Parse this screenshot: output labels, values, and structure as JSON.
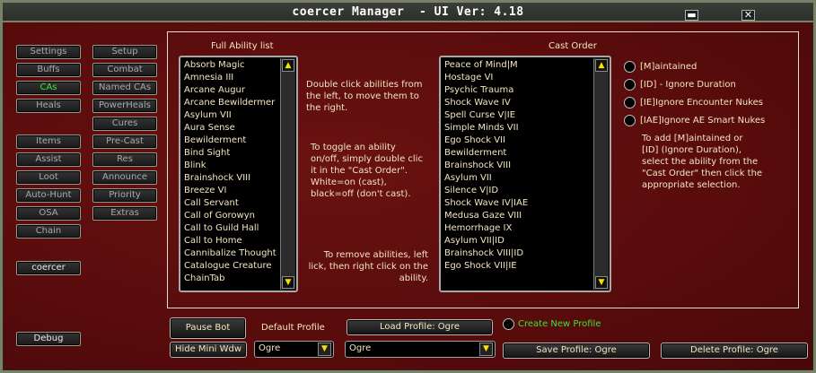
{
  "window": {
    "title": "coercer Manager  - UI Ver: 4.18",
    "minimize_glyph": "▬",
    "close_glyph": "✕"
  },
  "left_nav": {
    "col1": [
      "Settings",
      "Buffs",
      "CAs",
      "Heals"
    ],
    "col1b": [
      "Items",
      "Assist",
      "Loot",
      "Auto-Hunt",
      "OSA",
      "Chain"
    ],
    "col2": [
      "Setup",
      "Combat",
      "Named CAs",
      "PowerHeals",
      "Cures",
      "Pre-Cast",
      "Res",
      "Announce",
      "Priority",
      "Extras"
    ],
    "character": "coercer",
    "debug": "Debug",
    "active_item": "CAs"
  },
  "full_list": {
    "title": "Full Ability list",
    "items": [
      "Absorb Magic",
      "Amnesia III",
      "Arcane Augur",
      "Arcane Bewildermer",
      "Asylum VII",
      "Aura Sense",
      "Bewilderment",
      "Bind Sight",
      "Blink",
      "Brainshock VIII",
      "Breeze VI",
      "Call Servant",
      "Call of Gorowyn",
      "Call to Guild Hall",
      "Call to Home",
      "Cannibalize Thought",
      "Catalogue Creature",
      "ChainTab"
    ]
  },
  "cast_order": {
    "title": "Cast Order",
    "items": [
      "Peace of Mind|M",
      "Hostage VI",
      "Psychic Trauma",
      "Shock Wave IV",
      "Spell Curse V|IE",
      "Simple Minds VII",
      "Ego Shock VII",
      "Bewilderment",
      "Brainshock VIII",
      "Asylum VII",
      "Silence V|ID",
      "Shock Wave IV|IAE",
      "Medusa Gaze VIII",
      "Hemorrhage IX",
      "Asylum VII|ID",
      "Brainshock VIII|ID",
      "Ego Shock VII|IE"
    ]
  },
  "help": {
    "move": [
      "Double click abilities from",
      "the left, to move them to",
      "the right."
    ],
    "toggle": [
      "To toggle an ability",
      "on/off, simply double clic",
      "it in the \"Cast Order\".",
      "White=on (cast),",
      "black=off (don't cast)."
    ],
    "remove": [
      "To remove abilities, left",
      "lick, then right click on the",
      "ability."
    ],
    "flags": [
      "To add [M]aintained or",
      "[ID] (Ignore Duration),",
      "select the ability from the",
      "\"Cast Order\" then click the",
      "appropriate selection."
    ]
  },
  "options": [
    "[M]aintained",
    "[ID] - Ignore Duration",
    "[IE]Ignore Encounter Nukes",
    "[IAE]Ignore AE Smart Nukes"
  ],
  "bottom": {
    "pause_bot": "Pause Bot",
    "hide_mini": "Hide Mini Wdw",
    "default_profile_label": "Default Profile",
    "default_profile_value": "Ogre",
    "load_profile": "Load Profile: Ogre",
    "profile_select_value": "Ogre",
    "create_new_profile": "Create New Profile",
    "save_profile": "Save Profile: Ogre",
    "delete_profile": "Delete Profile: Ogre"
  },
  "colors": {
    "background": "#5d0d0d",
    "active_text": "#3ee23e",
    "scroll_arrow": "#f5e200"
  }
}
